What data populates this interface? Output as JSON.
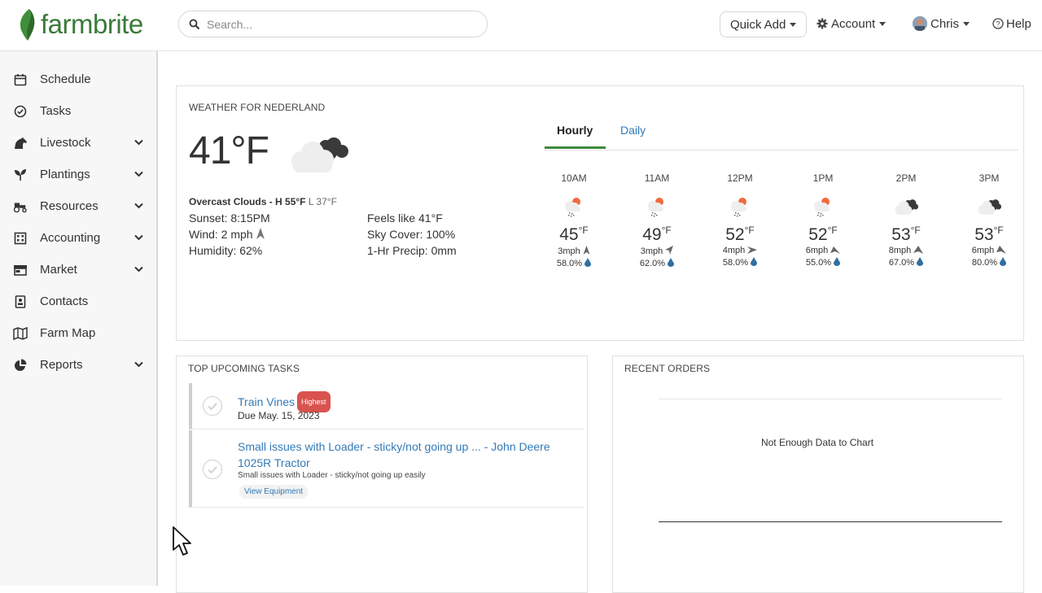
{
  "topbar": {
    "logo_text": "farmbrite",
    "search_placeholder": "Search...",
    "quick_add": "Quick Add",
    "account": "Account",
    "user": "Chris",
    "help": "Help"
  },
  "sidebar": {
    "items": [
      {
        "label": "Schedule",
        "icon": "calendar-icon",
        "expandable": false
      },
      {
        "label": "Tasks",
        "icon": "check-circle-icon",
        "expandable": false
      },
      {
        "label": "Livestock",
        "icon": "horse-icon",
        "expandable": true
      },
      {
        "label": "Plantings",
        "icon": "seedling-icon",
        "expandable": true
      },
      {
        "label": "Resources",
        "icon": "tractor-icon",
        "expandable": true
      },
      {
        "label": "Accounting",
        "icon": "building-icon",
        "expandable": true
      },
      {
        "label": "Market",
        "icon": "store-icon",
        "expandable": true
      },
      {
        "label": "Contacts",
        "icon": "address-book-icon",
        "expandable": false
      },
      {
        "label": "Farm Map",
        "icon": "map-icon",
        "expandable": false
      },
      {
        "label": "Reports",
        "icon": "pie-chart-icon",
        "expandable": true
      }
    ]
  },
  "weather": {
    "title": "WEATHER FOR NEDERLAND",
    "current_temp": "41°F",
    "icon": "overcast-clouds-icon",
    "summary_bold": "Overcast Clouds - H 55°F",
    "summary_low": "L 37°F",
    "sunset": "Sunset: 8:15PM",
    "wind": "Wind: 2 mph",
    "humidity": "Humidity: 62%",
    "feels_like": "Feels like 41°F",
    "sky_cover": "Sky Cover: 100%",
    "precip": "1-Hr Precip: 0mm",
    "tabs": {
      "hourly": "Hourly",
      "daily": "Daily"
    },
    "hourly": [
      {
        "time": "10AM",
        "temp": "45",
        "unit": "°F",
        "wind": "3mph",
        "precip": "58.0%",
        "icon": "rain-sun-icon"
      },
      {
        "time": "11AM",
        "temp": "49",
        "unit": "°F",
        "wind": "3mph",
        "precip": "62.0%",
        "icon": "rain-sun-icon"
      },
      {
        "time": "12PM",
        "temp": "52",
        "unit": "°F",
        "wind": "4mph",
        "precip": "58.0%",
        "icon": "rain-sun-icon"
      },
      {
        "time": "1PM",
        "temp": "52",
        "unit": "°F",
        "wind": "6mph",
        "precip": "55.0%",
        "icon": "rain-sun-icon"
      },
      {
        "time": "2PM",
        "temp": "53",
        "unit": "°F",
        "wind": "8mph",
        "precip": "67.0%",
        "icon": "overcast-clouds-icon"
      },
      {
        "time": "3PM",
        "temp": "53",
        "unit": "°F",
        "wind": "6mph",
        "precip": "80.0%",
        "icon": "overcast-clouds-icon"
      }
    ]
  },
  "tasks": {
    "title": "TOP UPCOMING TASKS",
    "items": [
      {
        "title": "Train Vines",
        "badge": "Highest",
        "due": "Due May. 15, 2023"
      },
      {
        "title": "Small issues with Loader - sticky/not going up ... - John Deere 1025R Tractor",
        "sub": "Small issues with Loader - sticky/not going up easily",
        "link": "View Equipment"
      }
    ]
  },
  "orders": {
    "title": "RECENT ORDERS",
    "message": "Not Enough Data to Chart"
  },
  "colors": {
    "brand_green": "#3a7a3a",
    "link_blue": "#337ab7",
    "badge_red": "#d9534f",
    "active_tab": "#3b8a3e",
    "drop_blue": "#2f6fa3",
    "sun_orange": "#f06a3c"
  }
}
